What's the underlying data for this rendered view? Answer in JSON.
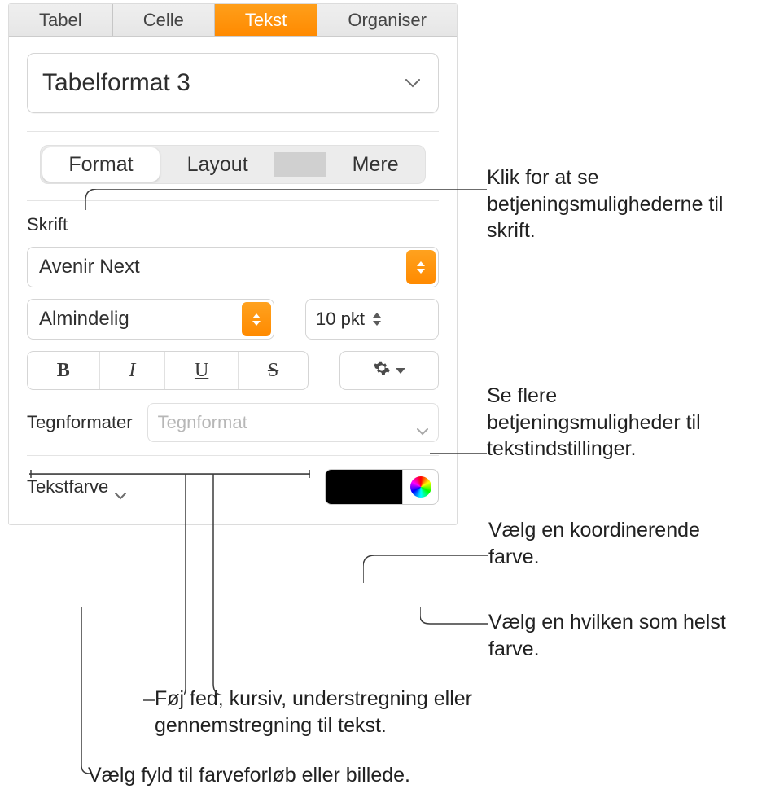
{
  "tabs": {
    "tabel": "Tabel",
    "celle": "Celle",
    "tekst": "Tekst",
    "organiser": "Organiser"
  },
  "paragraph_style": "Tabelformat 3",
  "segtabs": {
    "format": "Format",
    "layout": "Layout",
    "mere": "Mere"
  },
  "font_section_title": "Skrift",
  "font_family": "Avenir Next",
  "typeface": "Almindelig",
  "size_label": "10 pkt",
  "bius": {
    "b": "B",
    "i": "I",
    "u": "U",
    "s": "S"
  },
  "char_format_label": "Tegnformater",
  "char_format_placeholder": "Tegnformat",
  "text_color_label": "Tekstfarve",
  "color_swatch": "#000000",
  "callouts": {
    "format_tab": "Klik for at se betjeningsmulighederne til skrift.",
    "gear": "Se flere betjeningsmuligheder til tekstindstillinger.",
    "swatch": "Vælg en koordinerende farve.",
    "wheel": "Vælg en hvilken som helst farve.",
    "bius": "Føj fed, kursiv, understregning eller gennemstregning til tekst.",
    "textcolor": "Vælg fyld til farveforløb eller billede."
  }
}
